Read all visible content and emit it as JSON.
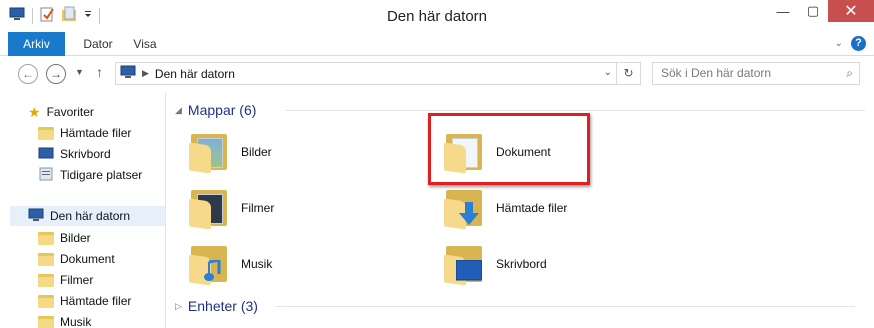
{
  "window": {
    "title": "Den här datorn",
    "controls": [
      "minimize-icon",
      "maximize-icon",
      "close-icon"
    ]
  },
  "ribbon": {
    "tabs": [
      {
        "label": "Arkiv",
        "active": true
      },
      {
        "label": "Dator"
      },
      {
        "label": "Visa"
      }
    ],
    "accent": "#1979ca"
  },
  "address": {
    "crumb": "Den här datorn",
    "search_placeholder": "Sök i Den här datorn"
  },
  "nav": {
    "favorites_label": "Favoriter",
    "favorites": [
      "Hämtade filer",
      "Skrivbord",
      "Tidigare platser"
    ],
    "computer_label": "Den här datorn",
    "computer_items": [
      "Bilder",
      "Dokument",
      "Filmer",
      "Hämtade filer",
      "Musik"
    ]
  },
  "content": {
    "folders_header": "Mappar (6)",
    "folders": [
      {
        "label": "Bilder",
        "icon": "pictures-folder-icon"
      },
      {
        "label": "Dokument",
        "icon": "documents-folder-icon"
      },
      {
        "label": "Filmer",
        "icon": "videos-folder-icon"
      },
      {
        "label": "Hämtade filer",
        "icon": "downloads-folder-icon"
      },
      {
        "label": "Musik",
        "icon": "music-folder-icon"
      },
      {
        "label": "Skrivbord",
        "icon": "desktop-folder-icon"
      }
    ],
    "devices_header": "Enheter (3)",
    "highlight_color": "#e02020"
  }
}
